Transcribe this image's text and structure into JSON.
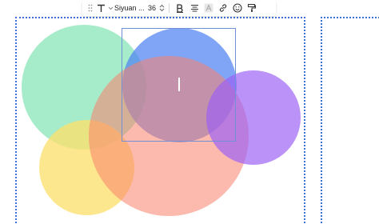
{
  "toolbar": {
    "text_style_icon": "text-t-icon",
    "font_name": "Siyuan ...",
    "font_size": "36",
    "icons": [
      "drag-grip-icon",
      "text-t-icon",
      "chevron-down-icon",
      "stepper-icon",
      "bold-icon",
      "align-center-icon",
      "text-highlight-icon",
      "link-icon",
      "emoji-icon",
      "format-painter-icon"
    ]
  },
  "canvas": {
    "colors": {
      "frame_border": "#3d6fd6",
      "green": "#7ee3b1",
      "yellow": "#fde27a",
      "blue": "#5b8ef2",
      "salmon": "#fb9a86",
      "purple": "#a879f5",
      "selection": "#6f8fd8"
    }
  }
}
